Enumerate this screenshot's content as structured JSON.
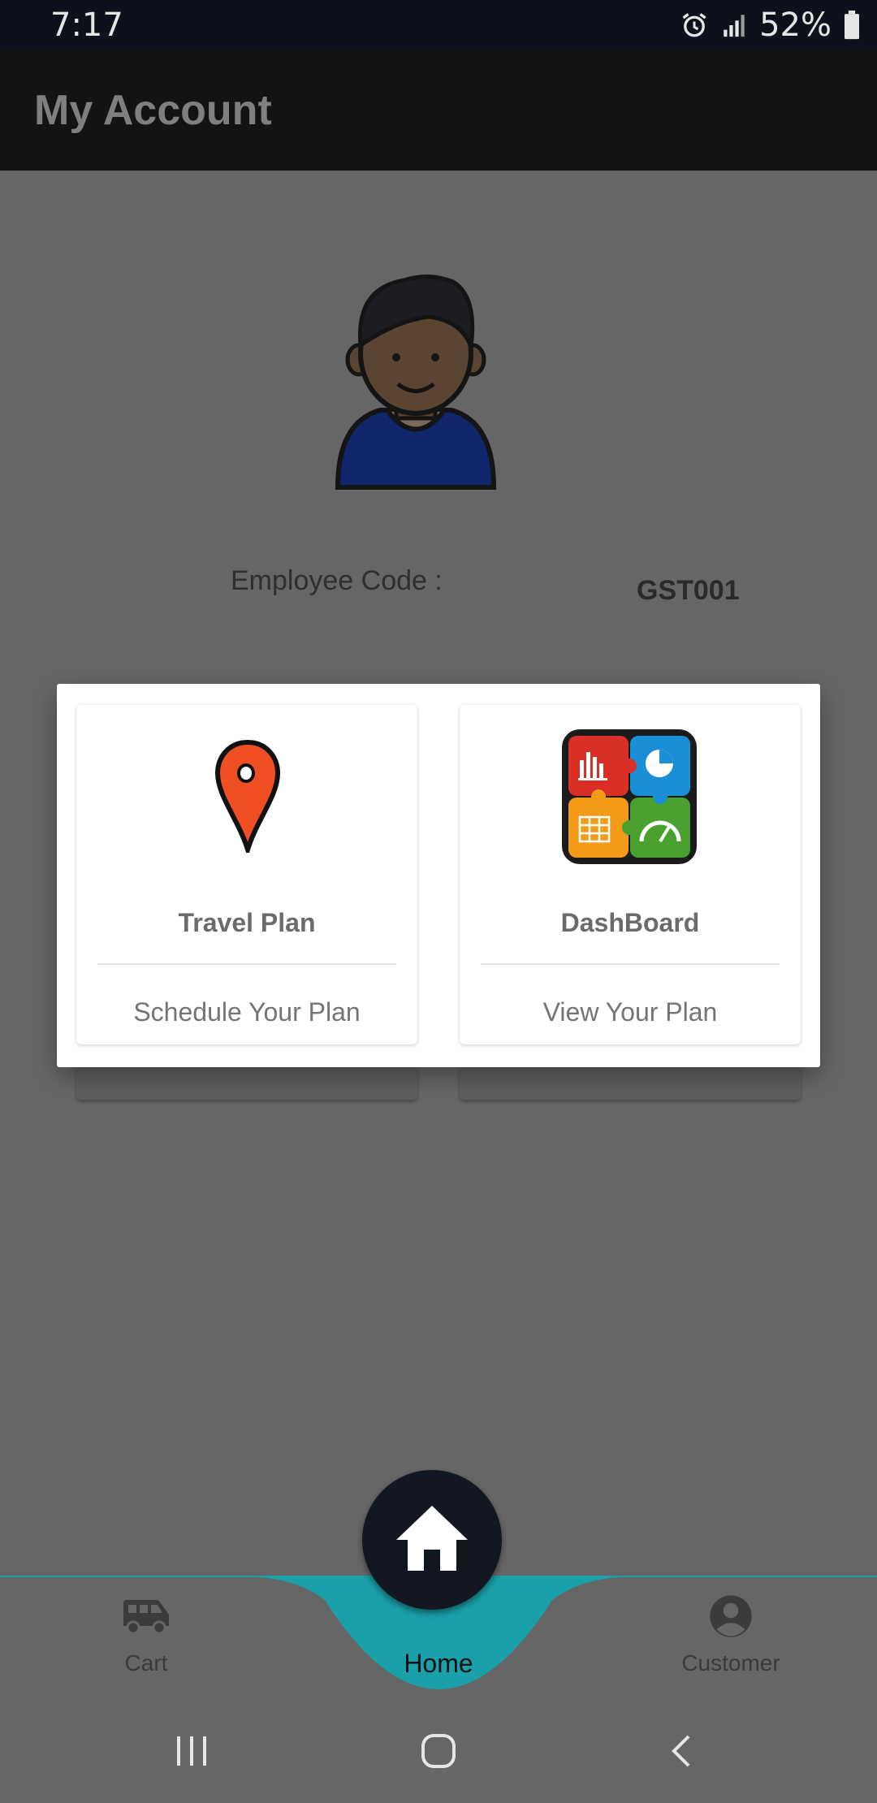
{
  "status_bar": {
    "time": "7:17",
    "battery": "52%",
    "icons": [
      "alarm-icon",
      "signal-icon",
      "battery-icon"
    ]
  },
  "app_bar": {
    "title": "My Account"
  },
  "profile": {
    "avatar_icon": "user-avatar-icon",
    "employee_code_label": "Employee Code :",
    "employee_code_value": "GST001"
  },
  "dialog": {
    "cards": [
      {
        "icon": "location-pin-icon",
        "title": "Travel Plan",
        "subtitle": "Schedule Your Plan"
      },
      {
        "icon": "dashboard-puzzle-icon",
        "title": "DashBoard",
        "subtitle": "View Your Plan"
      }
    ]
  },
  "bottom_nav": {
    "items": [
      {
        "icon": "van-icon",
        "label": "Cart"
      },
      {
        "icon": "home-icon",
        "label": "Home"
      },
      {
        "icon": "account-circle-icon",
        "label": "Customer"
      }
    ],
    "accent_color": "#1aa0a8"
  },
  "system_nav": {
    "icons": [
      "recents-icon",
      "home-circle-icon",
      "back-icon"
    ]
  }
}
